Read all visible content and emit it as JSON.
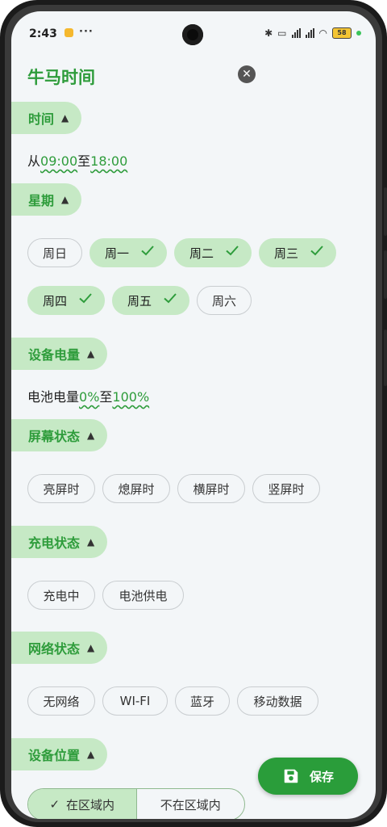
{
  "status_bar": {
    "time": "2:43",
    "dots": "···",
    "battery": "58"
  },
  "header": {
    "title": "牛马时间"
  },
  "time_section": {
    "label": "时间",
    "prefix": "从",
    "start": "09:00",
    "mid": "至",
    "end": "18:00"
  },
  "week_section": {
    "label": "星期",
    "days": [
      {
        "label": "周日",
        "selected": false
      },
      {
        "label": "周一",
        "selected": true
      },
      {
        "label": "周二",
        "selected": true
      },
      {
        "label": "周三",
        "selected": true
      },
      {
        "label": "周四",
        "selected": true
      },
      {
        "label": "周五",
        "selected": true
      },
      {
        "label": "周六",
        "selected": false
      }
    ]
  },
  "battery_section": {
    "label": "设备电量",
    "prefix": "电池电量",
    "min": "0%",
    "mid": "至",
    "max": "100%"
  },
  "screen_section": {
    "label": "屏幕状态",
    "options": [
      "亮屏时",
      "熄屏时",
      "横屏时",
      "竖屏时"
    ]
  },
  "charge_section": {
    "label": "充电状态",
    "options": [
      "充电中",
      "电池供电"
    ]
  },
  "network_section": {
    "label": "网络状态",
    "options": [
      "无网络",
      "WI-FI",
      "蓝牙",
      "移动数据"
    ]
  },
  "location_section": {
    "label": "设备位置",
    "in_area": "在区域内",
    "out_area": "不在区域内"
  },
  "fab": {
    "label": "保存"
  },
  "colors": {
    "accent": "#2e9c3b",
    "chip_selected": "#c6e9c5",
    "fab": "#2a9d3a"
  }
}
